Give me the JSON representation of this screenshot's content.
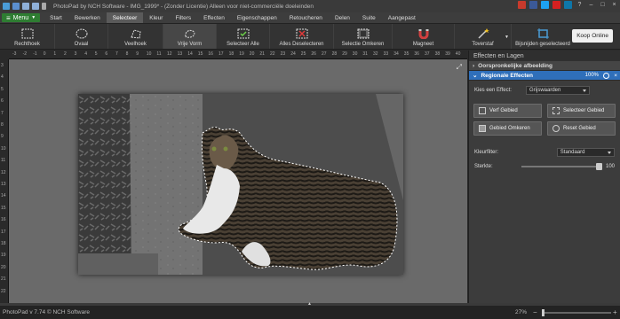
{
  "titlebar": {
    "title": "PhotoPad by NCH Software - IMG_1999* - (Zonder Licentie) Alleen voor niet-commerciële doeleinden"
  },
  "menubar": {
    "menu_label": "Menu",
    "tabs": [
      "Start",
      "Bewerken",
      "Selecteer",
      "Kleur",
      "Filters",
      "Effecten",
      "Eigenschappen",
      "Retoucheren",
      "Delen",
      "Suite",
      "Aangepast"
    ],
    "active_tab": "Selecteer"
  },
  "ribbon": {
    "buttons": [
      {
        "label": "Rechthoek",
        "icon": "rectangle-select-icon"
      },
      {
        "label": "Ovaal",
        "icon": "ellipse-select-icon"
      },
      {
        "label": "Veelhoek",
        "icon": "polygon-select-icon"
      },
      {
        "label": "Vrije Vorm",
        "icon": "freeform-select-icon"
      },
      {
        "label": "Selecteer Alle",
        "icon": "select-all-icon"
      },
      {
        "label": "Alles Deselecteren",
        "icon": "deselect-all-icon"
      },
      {
        "label": "Selectie Omkeren",
        "icon": "invert-selection-icon"
      },
      {
        "label": "Magneet",
        "icon": "magnet-icon"
      },
      {
        "label": "Toverstaf",
        "icon": "magic-wand-icon"
      },
      {
        "label": "Bijsnijden geselecteerd",
        "icon": "crop-selection-icon"
      }
    ],
    "active_button": "Vrije Vorm",
    "buy_label": "Koop Online"
  },
  "rulers": {
    "h_ticks": [
      "-3",
      "-2",
      "-1",
      "0",
      "1",
      "2",
      "3",
      "4",
      "5",
      "6",
      "7",
      "8",
      "9",
      "10",
      "11",
      "12",
      "13",
      "14",
      "15",
      "16",
      "17",
      "18",
      "19",
      "20",
      "21",
      "22",
      "23",
      "24",
      "25",
      "26",
      "27",
      "28",
      "29",
      "30",
      "31",
      "32",
      "33",
      "34",
      "35",
      "36",
      "37",
      "38",
      "39",
      "40"
    ],
    "v_ticks": [
      "3",
      "4",
      "5",
      "6",
      "7",
      "8",
      "9",
      "10",
      "11",
      "12",
      "13",
      "14",
      "15",
      "16",
      "17",
      "18",
      "19",
      "20",
      "21",
      "22"
    ]
  },
  "panel": {
    "title": "Effecten en Lagen",
    "original_label": "Oorspronkelijke afbeelding",
    "regional_label": "Regionale Effecten",
    "regional_zoom": "100%",
    "effect_label": "Kies een Effect:",
    "effect_value": "Grijswaarden",
    "btn_paint": "Verf Gebied",
    "btn_select": "Selecteer Gebied",
    "btn_invert": "Gebied Omkeren",
    "btn_reset": "Reset Gebied",
    "color_filter_label": "Kleurfilter:",
    "color_filter_value": "Standaard",
    "strength_label": "Sterkte:",
    "strength_value": "100"
  },
  "status": {
    "version": "PhotoPad v 7.74 © NCH Software",
    "zoom": "27%"
  },
  "colors": {
    "accent_green": "#2e7d32",
    "accent_blue": "#2f6fba"
  }
}
